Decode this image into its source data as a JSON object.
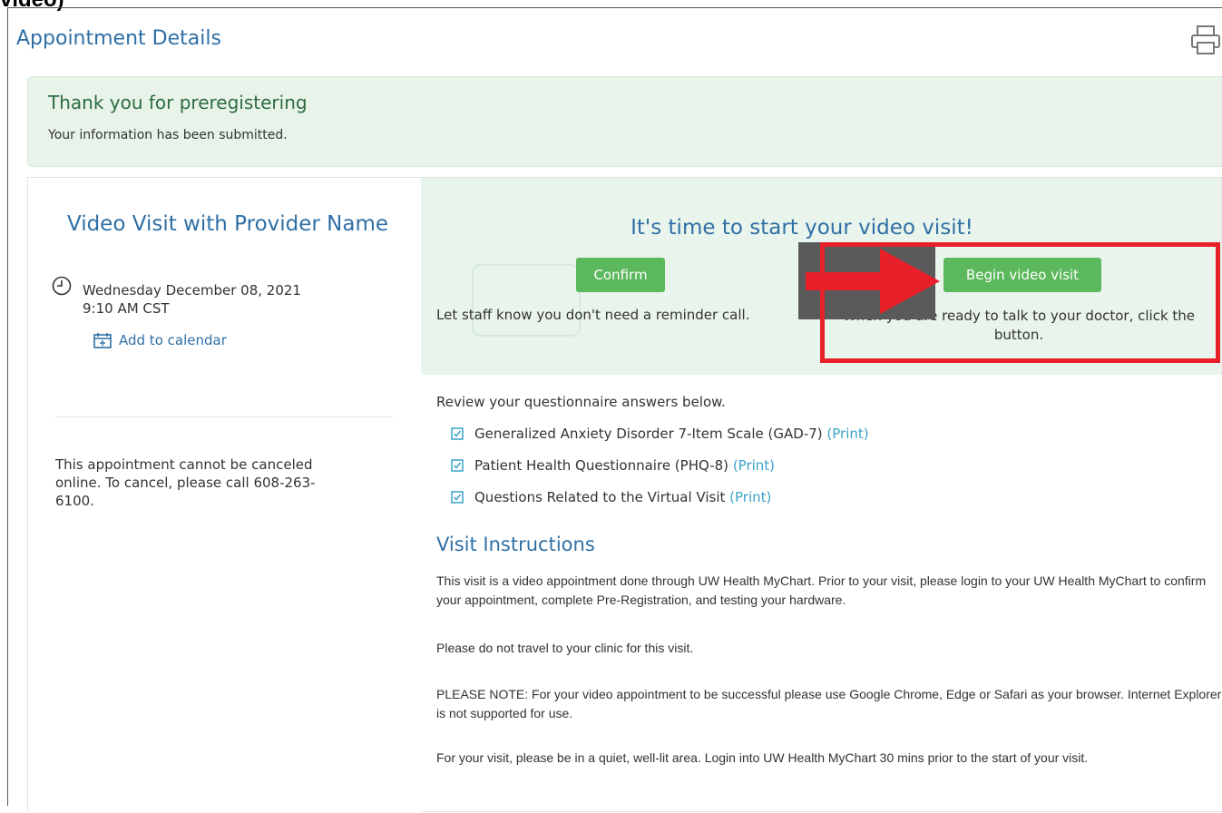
{
  "top_clip": "video)",
  "page": {
    "title": "Appointment Details",
    "print_icon": "printer-icon"
  },
  "banner": {
    "title": "Thank you for preregistering",
    "subtitle": "Your information has been submitted."
  },
  "appointment": {
    "title": "Video Visit with Provider Name",
    "date": "Wednesday December 08, 2021",
    "time": "9:10 AM CST",
    "add_to_calendar": "Add to calendar",
    "cancel_note": "This appointment cannot be canceled online. To cancel, please call 608-263-6100."
  },
  "video": {
    "headline": "It's time to start your video visit!",
    "confirm_label": "Confirm",
    "confirm_desc": "Let staff know you don't need a reminder call.",
    "begin_label": "Begin video visit",
    "begin_desc": "When you are ready to talk to your doctor, click the button."
  },
  "questionnaires": {
    "intro": "Review your questionnaire answers below.",
    "items": [
      {
        "name": "Generalized Anxiety Disorder 7-Item Scale (GAD-7)",
        "print": "(Print)"
      },
      {
        "name": "Patient Health Questionnaire (PHQ-8)",
        "print": "(Print)"
      },
      {
        "name": "Questions Related to the Virtual Visit",
        "print": "(Print)"
      }
    ]
  },
  "instructions": {
    "title": "Visit Instructions",
    "paragraphs": [
      "This visit is a video appointment done through UW Health MyChart. Prior to your visit, please login to your UW Health MyChart to confirm your appointment, complete Pre-Registration, and testing your hardware.",
      "Please do not travel to your clinic for this visit.",
      "PLEASE NOTE:  For your video appointment to be successful please use Google Chrome, Edge or Safari as your browser.  Internet Explorer is not supported for use.",
      "For your visit, please be in a quiet, well-lit area.  Login into UW Health MyChart 30 mins prior to the start of your visit."
    ]
  },
  "colors": {
    "accent_blue": "#2f6fa5",
    "button_green": "#5cb85c",
    "panel_green": "#e9f5ec",
    "highlight_red": "#e8202a"
  }
}
